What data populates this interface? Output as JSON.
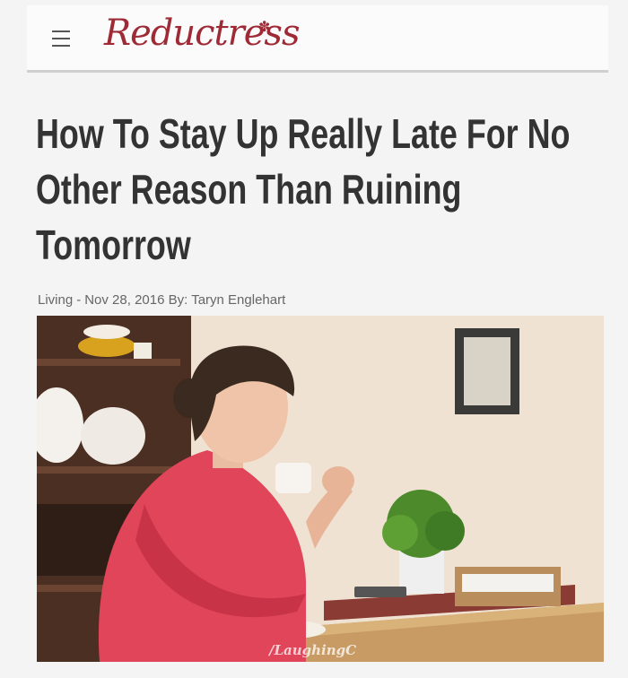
{
  "site": {
    "logo_text": "Reductress",
    "logo_flower": "✽"
  },
  "article": {
    "headline": "How To Stay Up Really Late For No Other Reason Than Ruining Tomorrow",
    "category": "Living",
    "separator": "-",
    "date": "Nov 28, 2016",
    "byline_prefix": "By:",
    "author": "Taryn Englehart"
  },
  "image": {
    "watermark": "/LaughingC"
  },
  "colors": {
    "brand": "#9e2a35",
    "headline": "#333333",
    "shirt": "#e0455a"
  },
  "icons": [
    "menu-icon"
  ]
}
